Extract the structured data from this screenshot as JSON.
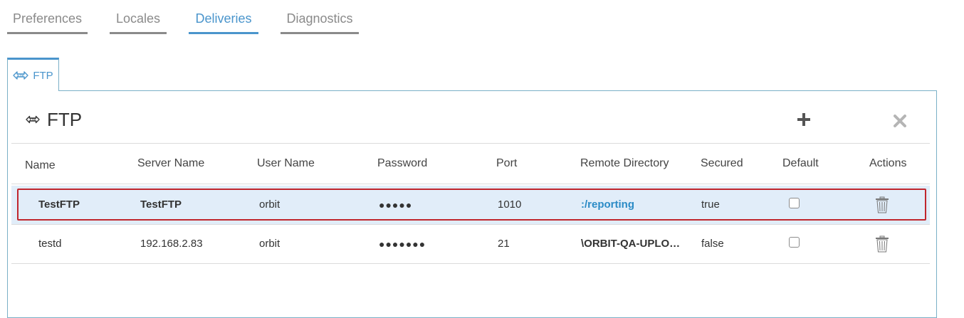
{
  "tabs": [
    {
      "label": "Preferences",
      "active": false
    },
    {
      "label": "Locales",
      "active": false
    },
    {
      "label": "Deliveries",
      "active": true
    },
    {
      "label": "Diagnostics",
      "active": false
    }
  ],
  "subtab": {
    "label": "FTP",
    "icon": "ftp-arrows-icon"
  },
  "panel": {
    "title": "FTP",
    "title_icon": "ftp-arrows-icon",
    "add_icon": "plus-icon",
    "close_icon": "close-icon"
  },
  "table": {
    "columns": [
      "Name",
      "Server Name",
      "User Name",
      "Password",
      "Port",
      "Remote Directory",
      "Secured",
      "Default",
      "Actions"
    ],
    "rows": [
      {
        "name": "TestFTP",
        "server": "TestFTP",
        "user": "orbit",
        "password": "●●●●●",
        "port": "1010",
        "remote_dir": ":/reporting",
        "secured": "true",
        "default": false,
        "selected": true
      },
      {
        "name": "testd",
        "server": "192.168.2.83",
        "user": "orbit",
        "password": "●●●●●●●",
        "port": "21",
        "remote_dir": "\\ORBIT-QA-UPLO…",
        "secured": "false",
        "default": false,
        "selected": false
      }
    ]
  },
  "colors": {
    "accent": "#4a95cc",
    "selection_bg": "#e1edf9",
    "selection_border": "#c0262d",
    "link": "#2b8bc6"
  }
}
